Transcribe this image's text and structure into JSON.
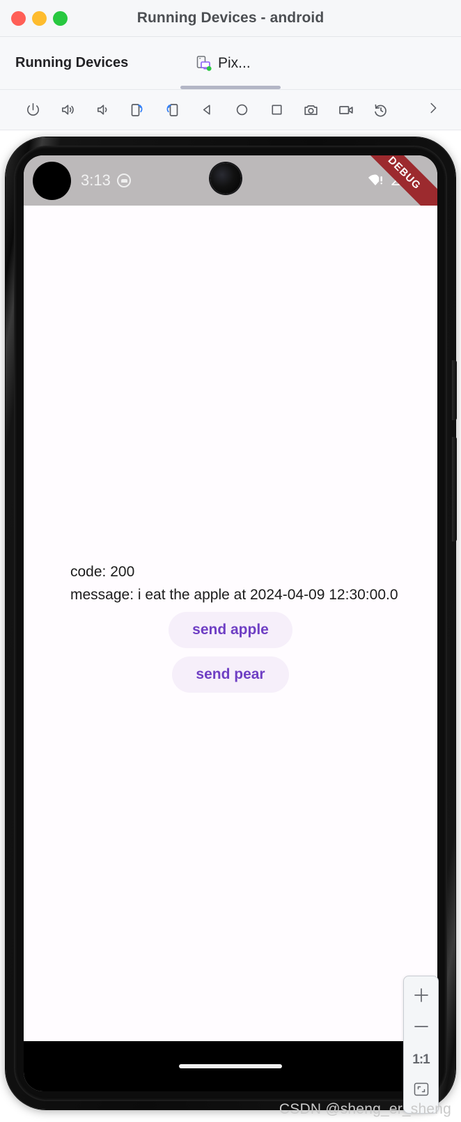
{
  "window": {
    "title": "Running Devices - android",
    "traffic_lights": [
      {
        "name": "close",
        "color": "#ff5f57"
      },
      {
        "name": "minimize",
        "color": "#febc2e"
      },
      {
        "name": "zoom",
        "color": "#28c840"
      }
    ]
  },
  "tool_window": {
    "title": "Running Devices",
    "tab": {
      "label": "Pix...",
      "icon": "emulator-device-icon",
      "status": "running",
      "status_color": "#28c840"
    }
  },
  "device_toolbar": {
    "buttons": [
      {
        "name": "power-button",
        "icon": "power-icon"
      },
      {
        "name": "volume-up-button",
        "icon": "volume-up-icon"
      },
      {
        "name": "volume-down-button",
        "icon": "volume-down-icon"
      },
      {
        "name": "rotate-right-button",
        "icon": "rotate-right-icon",
        "accent": "#2f7df6"
      },
      {
        "name": "rotate-left-button",
        "icon": "rotate-left-icon",
        "accent": "#2f7df6"
      },
      {
        "name": "back-button",
        "icon": "back-triangle-icon"
      },
      {
        "name": "home-button",
        "icon": "home-circle-icon"
      },
      {
        "name": "overview-button",
        "icon": "overview-square-icon"
      },
      {
        "name": "screenshot-button",
        "icon": "camera-icon"
      },
      {
        "name": "screen-record-button",
        "icon": "video-camera-icon"
      },
      {
        "name": "restore-button",
        "icon": "history-rotate-icon"
      }
    ],
    "overflow_label": "›"
  },
  "device_screen": {
    "status_bar": {
      "time": "3:13",
      "notification_icon": "notification-dot-icon",
      "wifi_icon": "wifi-warning-icon",
      "cellular_icon": "cellular-signal-icon",
      "battery_icon": "battery-icon",
      "debug_banner": "DEBUG",
      "debug_banner_color": "#9c2a2e",
      "background_color": "#bcb9ba"
    },
    "app": {
      "line_code": "code: 200",
      "line_message": "message: i eat the apple at 2024-04-09 12:30:00.0",
      "buttons": [
        {
          "name": "send-apple-button",
          "label": "send apple"
        },
        {
          "name": "send-pear-button",
          "label": "send pear"
        }
      ],
      "button_text_color": "#6f3fc4",
      "button_bg_color": "#f6effa",
      "background_color": "#fffcff"
    },
    "nav_bar": {
      "gesture_pill": "home-gesture-pill"
    }
  },
  "zoom_panel": {
    "zoom_in_label": "+",
    "zoom_out_label": "−",
    "actual_size_label": "1:1",
    "fit_label": "fit-to-screen-icon"
  },
  "watermark": "CSDN @sheng_er_sheng"
}
